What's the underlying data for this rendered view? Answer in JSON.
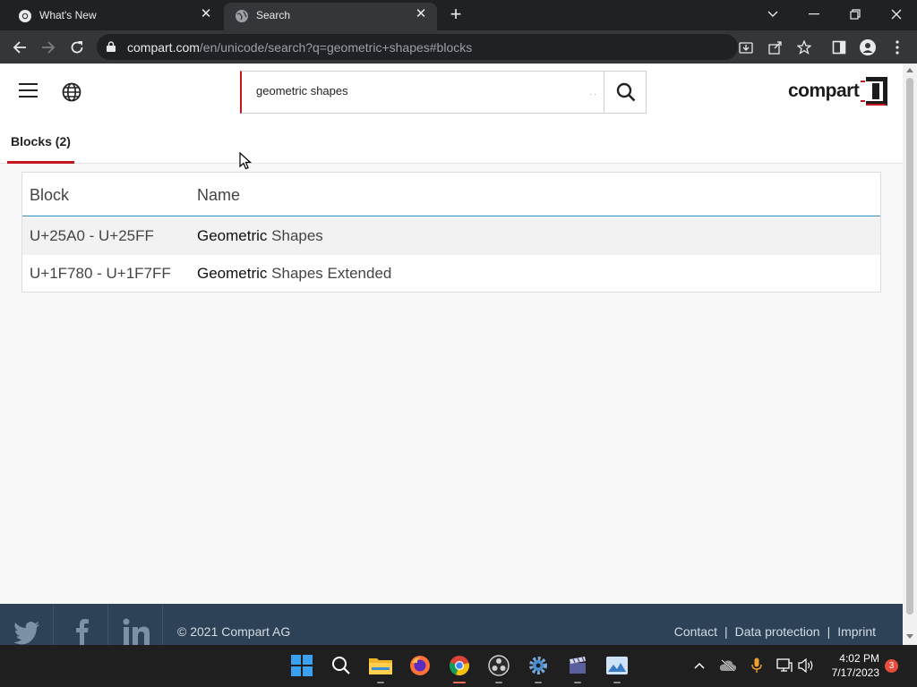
{
  "browser": {
    "tabs": [
      {
        "title": "What's New",
        "active": false
      },
      {
        "title": "Search",
        "active": true
      }
    ],
    "url_host": "compart.com",
    "url_path": "/en/unicode/search?q=geometric+shapes#blocks"
  },
  "site": {
    "search_value": "geometric shapes",
    "logo_text": "compart",
    "brand_color": "#c4161c"
  },
  "results": {
    "tab_label": "Blocks (2)",
    "headers": {
      "block": "Block",
      "name": "Name"
    },
    "rows": [
      {
        "block": "U+25A0 - U+25FF",
        "name_match": "Geometric",
        "name_rest": " Shapes"
      },
      {
        "block": "U+1F780 - U+1F7FF",
        "name_match": "Geometric",
        "name_rest": " Shapes Extended"
      }
    ]
  },
  "footer": {
    "copyright": "© 2021 Compart AG",
    "links": [
      "Contact",
      "Data protection",
      "Imprint"
    ],
    "separator": "|",
    "social": [
      "twitter-icon",
      "facebook-icon",
      "linkedin-icon"
    ]
  },
  "taskbar": {
    "time": "4:02 PM",
    "date": "7/17/2023",
    "notifications": "3"
  }
}
